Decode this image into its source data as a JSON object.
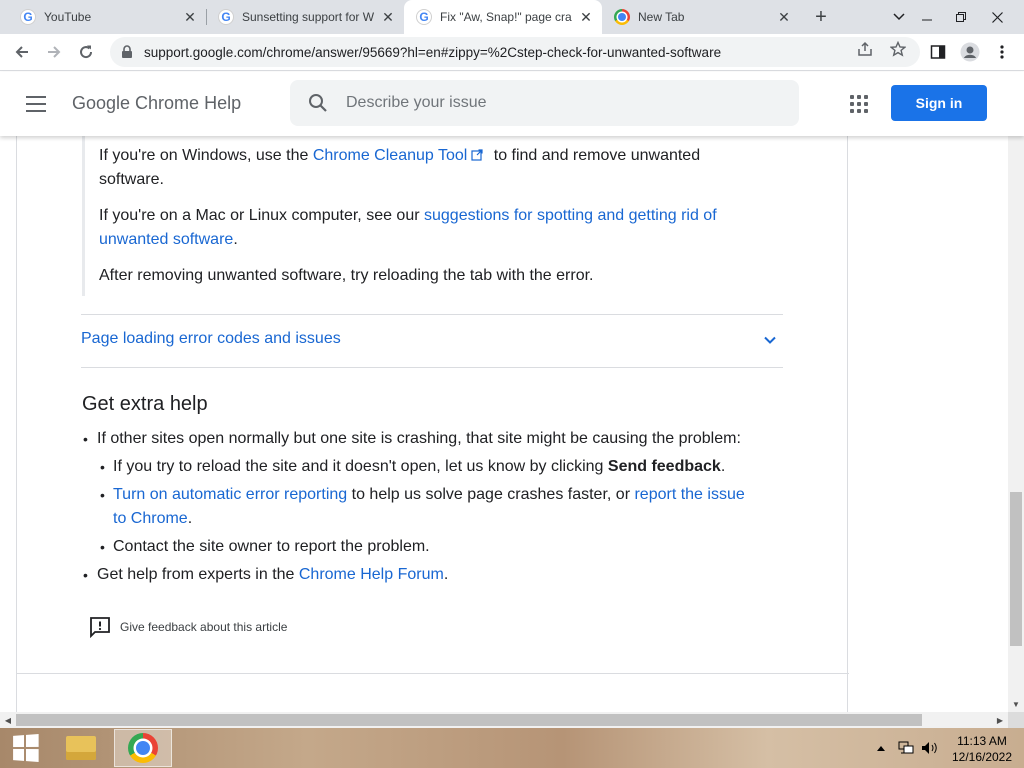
{
  "browser": {
    "tabs": [
      {
        "title": "YouTube",
        "favicon": "google-g-icon",
        "active": false
      },
      {
        "title": "Sunsetting support for W",
        "favicon": "google-g-icon",
        "active": false
      },
      {
        "title": "Fix \"Aw, Snap!\" page cra",
        "favicon": "google-g-icon",
        "active": true
      },
      {
        "title": "New Tab",
        "favicon": "chrome-icon",
        "active": false
      }
    ],
    "url": "support.google.com/chrome/answer/95669?hl=en#zippy=%2Cstep-check-for-unwanted-software"
  },
  "header": {
    "title": "Google Chrome Help",
    "search_placeholder": "Describe your issue",
    "signin_label": "Sign in"
  },
  "article": {
    "windows_prefix": "If you're on Windows, use the ",
    "cleanup_link": "Chrome Cleanup Tool",
    "windows_suffix_1": " to find and remove unwanted",
    "windows_suffix_2": "software.",
    "mac_prefix": "If you're on a Mac or Linux computer, see our ",
    "mac_link_1": "suggestions for spotting and getting rid of",
    "mac_link_2": "unwanted software",
    "mac_suffix": ".",
    "after_removing": "After removing unwanted software, try reloading the tab with the error.",
    "zippy_title": "Page loading error codes and issues",
    "extra_help_heading": "Get extra help",
    "bullet_1": "If other sites open normally but one site is crashing, that site might be causing the problem:",
    "sub_1_prefix": "If you try to reload the site and it doesn't open, let us know by clicking ",
    "sub_1_bold": "Send feedback",
    "sub_1_suffix": ".",
    "sub_2_link": "Turn on automatic error reporting",
    "sub_2_mid": " to help us solve page crashes faster, or ",
    "sub_2_link_2a": "report the issue",
    "sub_2_link_2b": "to Chrome",
    "sub_2_suffix": ".",
    "sub_3": "Contact the site owner to report the problem.",
    "bullet_2_prefix": "Get help from experts in the ",
    "bullet_2_link": "Chrome Help Forum",
    "bullet_2_suffix": ".",
    "feedback_label": "Give feedback about this article"
  },
  "taskbar": {
    "time": "11:13 AM",
    "date": "12/16/2022"
  },
  "colors": {
    "link": "#1967d2",
    "signin_bg": "#1a73e8",
    "tabstrip_bg": "#dee1e6"
  }
}
